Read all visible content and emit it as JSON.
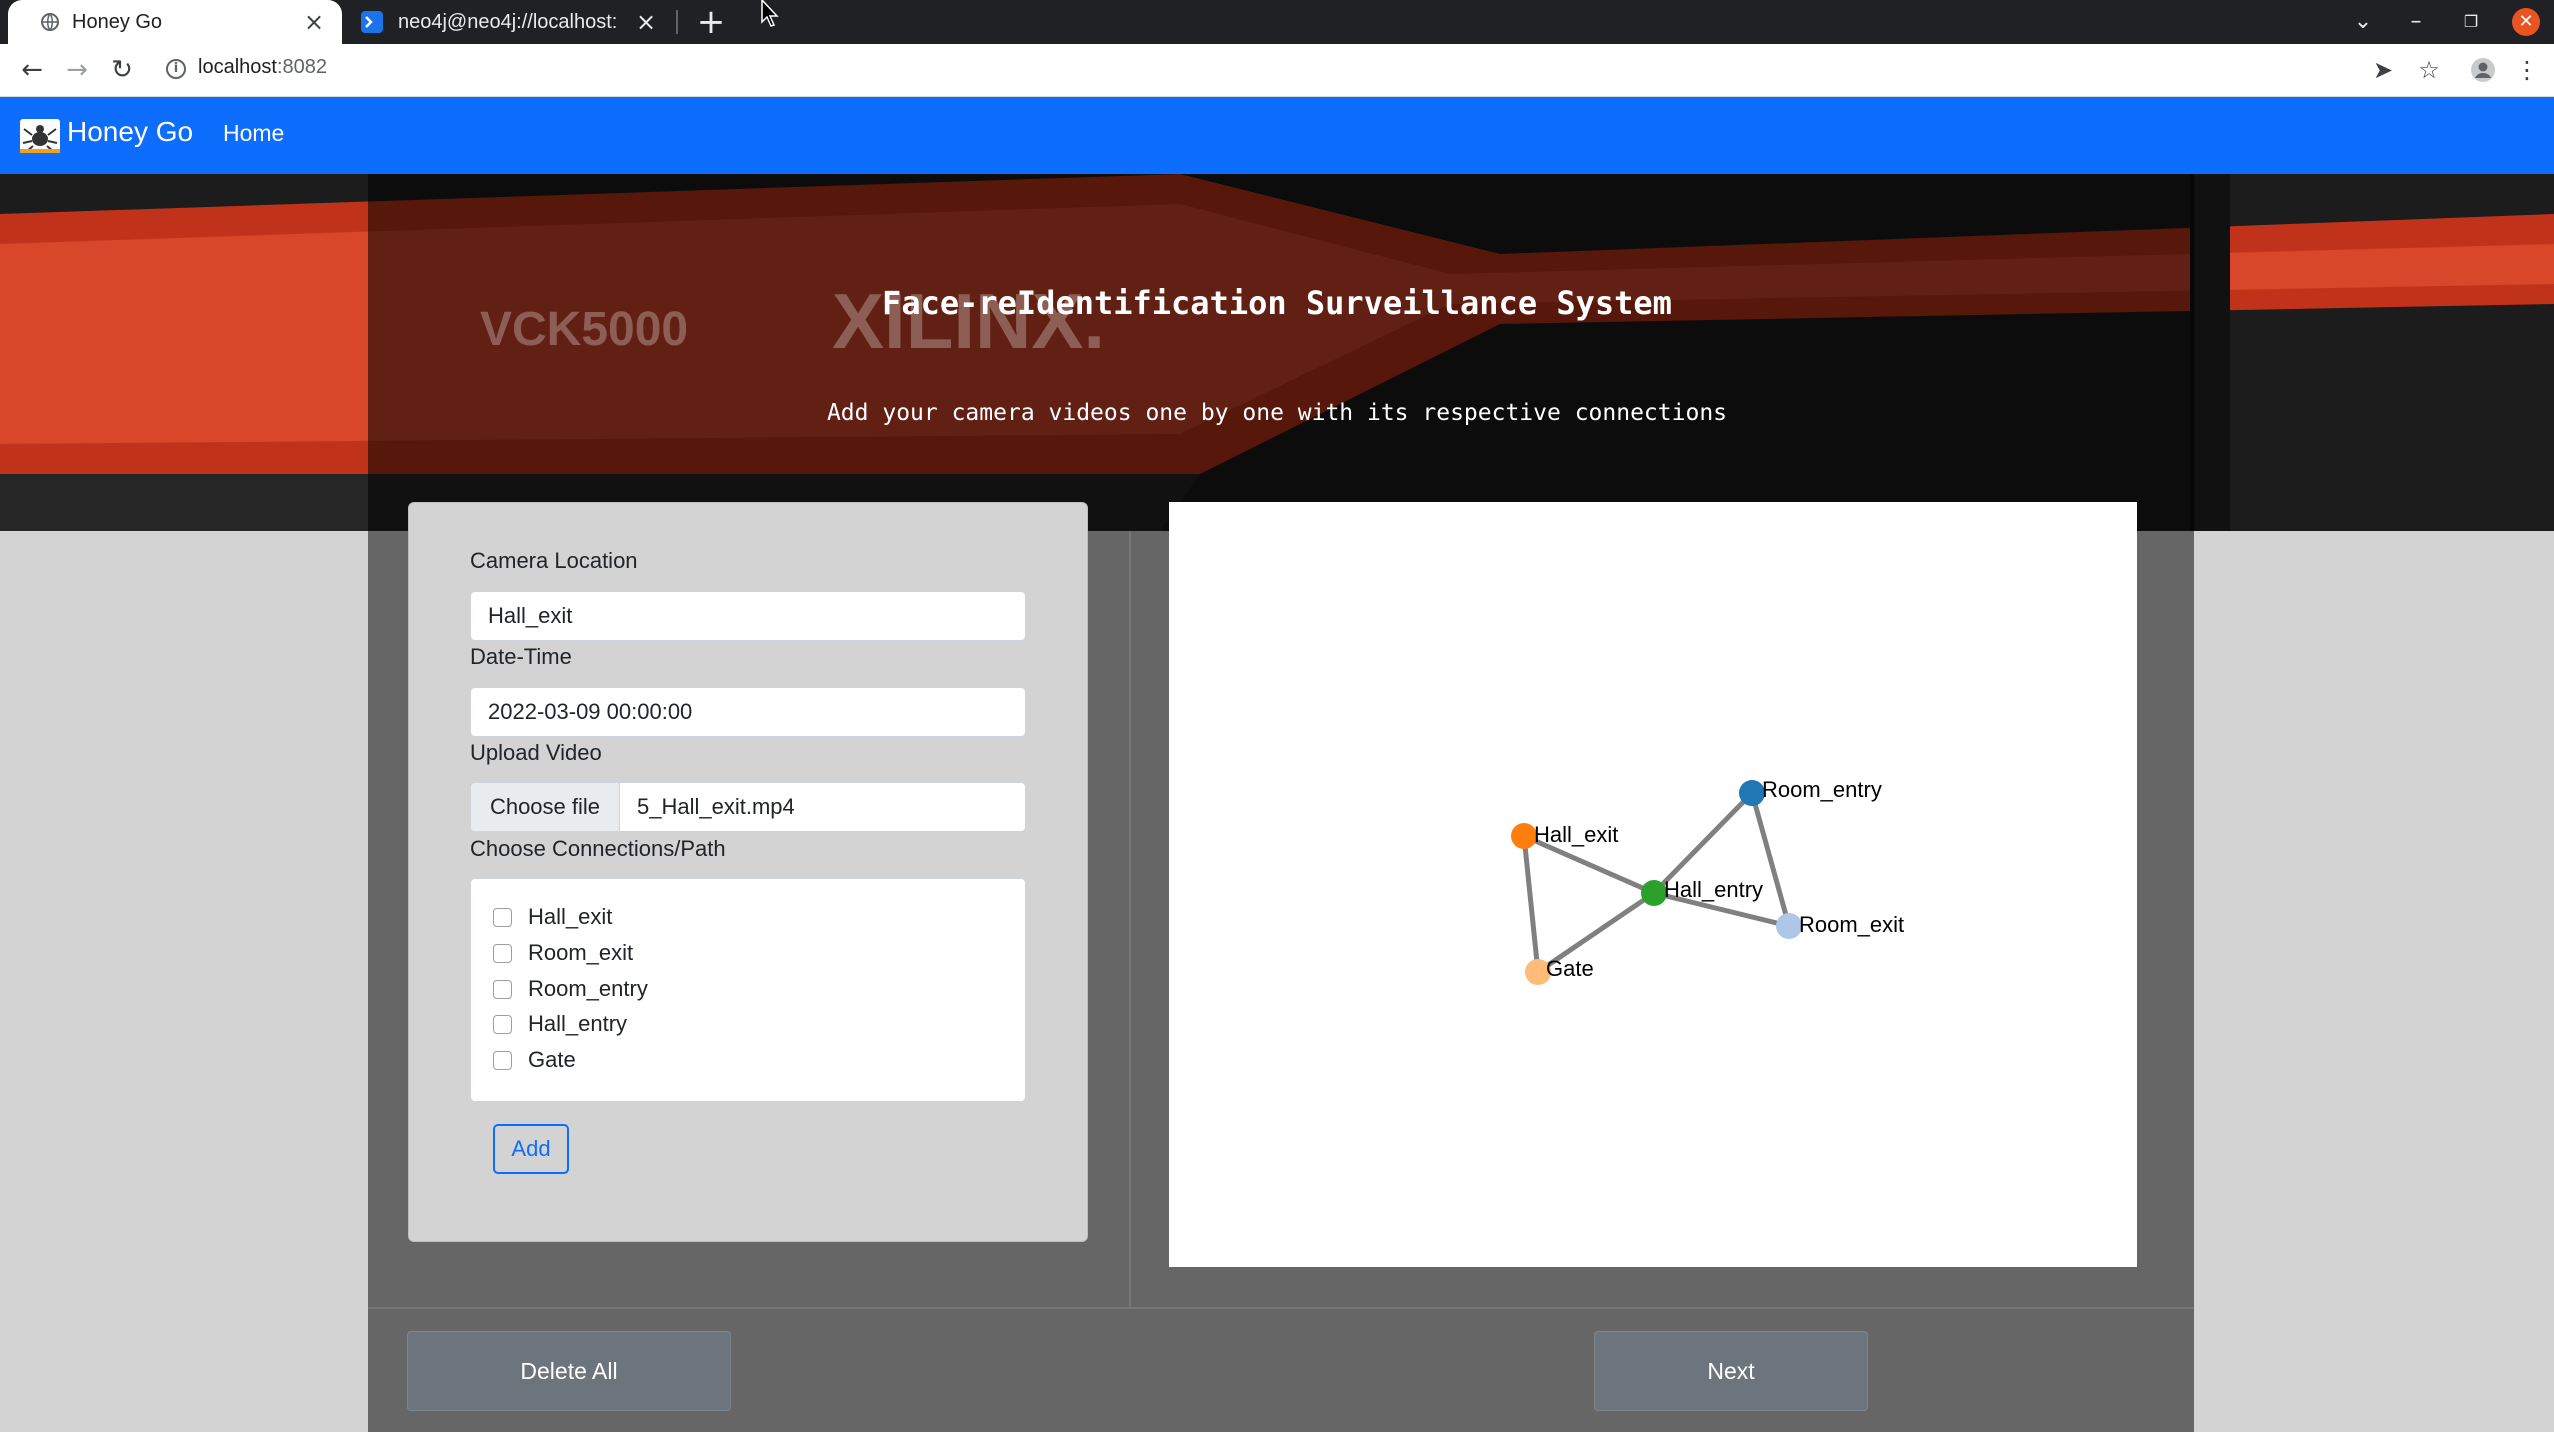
{
  "browser": {
    "tabs": [
      {
        "title": "Honey Go",
        "active": true,
        "icon": "globe-icon"
      },
      {
        "title": "neo4j@neo4j://localhost:",
        "active": false,
        "icon": "terminal-icon"
      }
    ],
    "url_host": "localhost",
    "url_port": ":8082"
  },
  "navbar": {
    "brand": "Honey Go",
    "links": [
      "Home"
    ]
  },
  "hero": {
    "title": "Face-reIdentification Surveillance System",
    "subtitle": "Add your camera videos one by one with its respective connections",
    "watermark_left": "VCK5000",
    "watermark_right": "XILINX."
  },
  "form": {
    "camera_location_label": "Camera Location",
    "camera_location_value": "Hall_exit",
    "datetime_label": "Date-Time",
    "datetime_value": "2022-03-09 00:00:00",
    "upload_label": "Upload Video",
    "choose_file_label": "Choose file",
    "file_name": "5_Hall_exit.mp4",
    "connections_label": "Choose Connections/Path",
    "connections": [
      "Hall_exit",
      "Room_exit",
      "Room_entry",
      "Hall_entry",
      "Gate"
    ],
    "add_label": "Add"
  },
  "graph": {
    "nodes": [
      {
        "id": "Hall_exit",
        "color": "#ff7f0e"
      },
      {
        "id": "Room_entry",
        "color": "#1f77b4"
      },
      {
        "id": "Hall_entry",
        "color": "#2ca02c"
      },
      {
        "id": "Room_exit",
        "color": "#aec7e8"
      },
      {
        "id": "Gate",
        "color": "#ffbb78"
      }
    ],
    "edges": [
      [
        "Hall_exit",
        "Hall_entry"
      ],
      [
        "Hall_exit",
        "Gate"
      ],
      [
        "Gate",
        "Hall_entry"
      ],
      [
        "Hall_entry",
        "Room_entry"
      ],
      [
        "Hall_entry",
        "Room_exit"
      ],
      [
        "Room_entry",
        "Room_exit"
      ]
    ],
    "edge_color": "#808080"
  },
  "buttons": {
    "delete_all": "Delete All",
    "next": "Next"
  },
  "colors": {
    "navbar": "#0d6efd",
    "panel": "#666666",
    "secondary_button": "#6c757d"
  }
}
